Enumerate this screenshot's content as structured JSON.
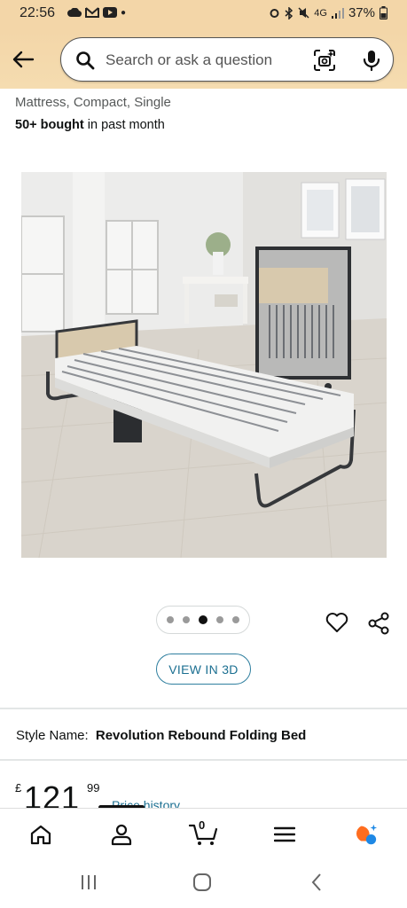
{
  "status_bar": {
    "time": "22:56",
    "battery": "37%",
    "network": "4G"
  },
  "header": {
    "search_placeholder": "Search or ask a question"
  },
  "product": {
    "title_fragment": "Mattress, Compact, Single",
    "bought_bold": "50+ bought",
    "bought_rest": " in past month",
    "view_3d_label": "VIEW IN 3D",
    "style_label": "Style Name:",
    "style_value": "Revolution Rebound Folding Bed",
    "price_currency": "£",
    "price_whole": "121",
    "price_fraction": "99",
    "price_history_label": "Price history"
  },
  "carousel": {
    "total_dots": 5,
    "active_index": 2
  },
  "bottom_nav": {
    "cart_count": "0"
  },
  "colors": {
    "header_bg": "#f3d6a8",
    "link": "#1b6f91",
    "ai_orange": "#ff6d1f",
    "ai_blue": "#1e88e5"
  }
}
